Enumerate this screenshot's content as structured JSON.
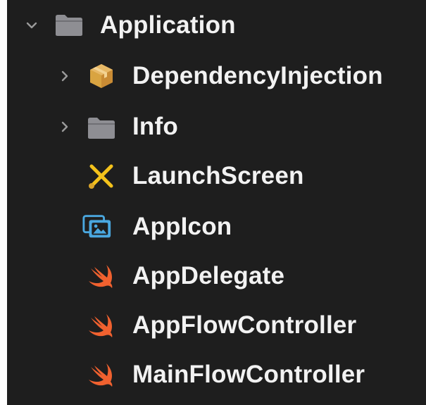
{
  "navigator": {
    "items": [
      {
        "label": "Application",
        "icon": "folder-icon",
        "disclosure": "expanded"
      },
      {
        "label": "DependencyInjection",
        "icon": "package-icon",
        "disclosure": "collapsed"
      },
      {
        "label": "Info",
        "icon": "folder-icon",
        "disclosure": "collapsed"
      },
      {
        "label": "LaunchScreen",
        "icon": "storyboard-icon",
        "disclosure": "none"
      },
      {
        "label": "AppIcon",
        "icon": "asset-catalog-icon",
        "disclosure": "none"
      },
      {
        "label": "AppDelegate",
        "icon": "swift-icon",
        "disclosure": "none"
      },
      {
        "label": "AppFlowController",
        "icon": "swift-icon",
        "disclosure": "none"
      },
      {
        "label": "MainFlowController",
        "icon": "swift-icon",
        "disclosure": "none"
      }
    ]
  },
  "colors": {
    "background": "#1e1e1e",
    "text": "#f2f2f2",
    "folder": "#8e8e93",
    "disclosure": "#9a9a9a",
    "package": "#d9a441",
    "storyboard": "#f4c21b",
    "asset_catalog": "#4aa8e0",
    "swift": "#f0612f"
  }
}
